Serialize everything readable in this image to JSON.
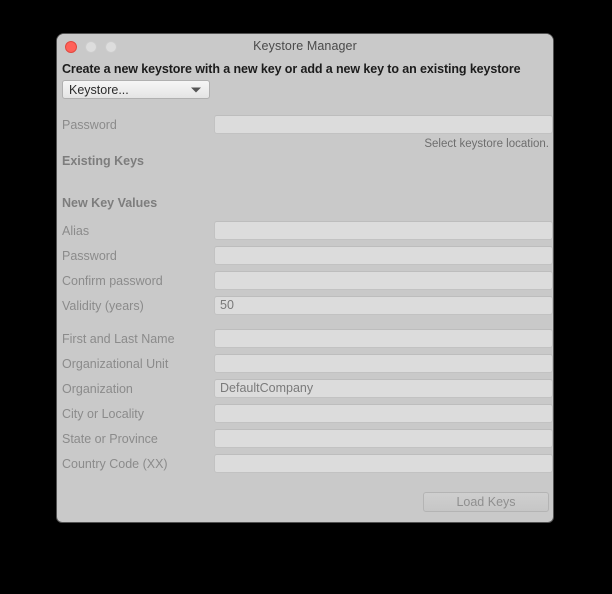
{
  "window": {
    "title": "Keystore Manager",
    "traffic_lights": [
      {
        "name": "close",
        "color": "#ff6159"
      },
      {
        "name": "minimize",
        "color": "#dddddd"
      },
      {
        "name": "zoom",
        "color": "#dddddd"
      }
    ]
  },
  "headline": "Create a new keystore with a new key or add a new key to an existing keystore",
  "keystore_select": {
    "value": "Keystore...",
    "icon": "chevron-down-icon"
  },
  "keystore_password": {
    "label": "Password",
    "value": "",
    "hint": "Select keystore location."
  },
  "sections": {
    "existing_keys": "Existing Keys",
    "new_key_values": "New Key Values"
  },
  "new_key_fields": [
    {
      "label": "Alias",
      "value": ""
    },
    {
      "label": "Password",
      "value": ""
    },
    {
      "label": "Confirm password",
      "value": ""
    },
    {
      "label": "Validity (years)",
      "value": "50"
    }
  ],
  "identity_fields": [
    {
      "label": "First and Last Name",
      "value": ""
    },
    {
      "label": "Organizational Unit",
      "value": ""
    },
    {
      "label": "Organization",
      "value": "DefaultCompany"
    },
    {
      "label": "City or Locality",
      "value": ""
    },
    {
      "label": "State or Province",
      "value": ""
    },
    {
      "label": "Country Code (XX)",
      "value": ""
    }
  ],
  "load_keys_button": "Load Keys",
  "colors": {
    "window_background": "#c9c9c9",
    "field_background": "#dcdcdc",
    "label_text": "#8b8b8b",
    "headline_text": "#1c1c1c",
    "desktop_background": "#000000"
  }
}
